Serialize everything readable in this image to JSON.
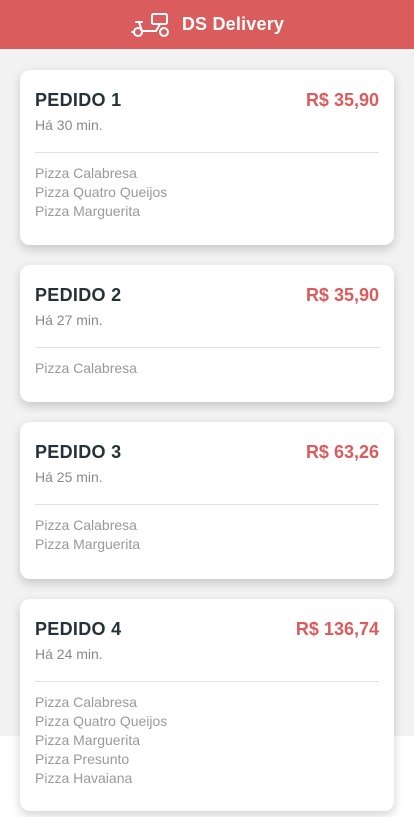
{
  "header": {
    "title": "DS Delivery",
    "logo_icon": "scooter-icon",
    "background": "#da5c5c"
  },
  "orders": [
    {
      "title": "PEDIDO 1",
      "price": "R$ 35,90",
      "time": "Há 30 min.",
      "items": [
        "Pizza Calabresa",
        "Pizza Quatro Queijos",
        "Pizza Marguerita"
      ]
    },
    {
      "title": "PEDIDO 2",
      "price": "R$ 35,90",
      "time": "Há 27 min.",
      "items": [
        "Pizza Calabresa"
      ]
    },
    {
      "title": "PEDIDO 3",
      "price": "R$ 63,26",
      "time": "Há 25 min.",
      "items": [
        "Pizza Calabresa",
        "Pizza Marguerita"
      ]
    },
    {
      "title": "PEDIDO 4",
      "price": "R$ 136,74",
      "time": "Há 24 min.",
      "items": [
        "Pizza Calabresa",
        "Pizza Quatro Queijos",
        "Pizza Marguerita",
        "Pizza Presunto",
        "Pizza Havaiana"
      ]
    }
  ],
  "colors": {
    "accent": "#da5c5c",
    "title_text": "#263238",
    "muted_text": "#9a9a9a"
  }
}
